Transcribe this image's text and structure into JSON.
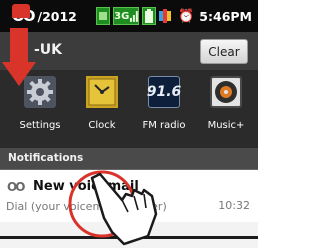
{
  "status_bar": {
    "voicemail_glyph": "OO",
    "date": "/2012",
    "network": "3G",
    "clock": "5:46PM"
  },
  "notification_panel": {
    "carrier": "-UK",
    "clear_label": "Clear"
  },
  "shortcuts": [
    {
      "label": "Settings",
      "icon": "gear-icon"
    },
    {
      "label": "Clock",
      "icon": "clock-icon"
    },
    {
      "label": "FM radio",
      "icon": "fm-radio-icon",
      "display": "91.6"
    },
    {
      "label": "Music+",
      "icon": "music-icon"
    }
  ],
  "notifications": {
    "header": "Notifications",
    "items": [
      {
        "icon": "voicemail-icon",
        "icon_glyph": "OO",
        "title": "New voicemail",
        "subtitle": "Dial (your voicemail number)",
        "time": "10:32"
      }
    ]
  },
  "colors": {
    "status_bar": "#0b0b0b",
    "shortcut_bg": "#2b2b2b",
    "arrow": "#d8342a",
    "tap_circle": "#d8342a",
    "network_green": "#1f8d21"
  }
}
